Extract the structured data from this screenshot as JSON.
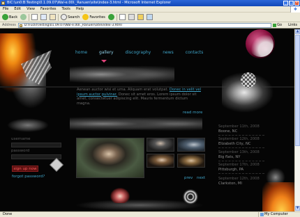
{
  "browser": {
    "title": "BiC:\\un0:B:Testing\\0.1.09.07\\Wal-e.00l._Ranuen\\site\\index-3.html - Microsoft Internet Explorer",
    "menu": [
      "File",
      "Edit",
      "View",
      "Favorites",
      "Tools",
      "Help"
    ],
    "toolbar": {
      "back": "Back",
      "search": "Search",
      "favorites": "Favorites"
    },
    "address_label": "Address",
    "address_value": "D:\\Fuckl\\Testing\\01.09.07\\Wal-e.00l._Ranuen\\site\\index-3.html",
    "go_label": "Go",
    "links_label": "Links",
    "status": {
      "left": "Done",
      "right": "My Computer"
    }
  },
  "site": {
    "nav": [
      "home",
      "gallery",
      "discography",
      "news",
      "contacts"
    ],
    "active_nav": "gallery",
    "intro": {
      "text": "Aenean auctor wisi et urna. Aliquam erat volutpat.",
      "link": "Donec in velit vel ipsum auctor pulvinar.",
      "text2": "Donec sit amet eros. Lorem ipsum dolor sit amet, consectetuer adipiscing elit. Mauris fermentum dictum magna."
    },
    "read_more": "read more",
    "login": {
      "username_label": "username",
      "password_label": "password",
      "signup": "sign up now",
      "forgot": "forgot password?"
    },
    "gallery_nav": {
      "prev": "prev",
      "next": "next"
    },
    "events": [
      {
        "date": "September 11th, 2008",
        "city": "Boone, NC"
      },
      {
        "date": "September 12th, 2008",
        "city": "Elizabeth City, NC"
      },
      {
        "date": "September 13th, 2008",
        "city": "Big flats, NY"
      },
      {
        "date": "September 17th, 2008",
        "city": "Pittsburgh, PA"
      },
      {
        "date": "September 12th, 2008",
        "city": "Clarkston, MI"
      }
    ]
  }
}
